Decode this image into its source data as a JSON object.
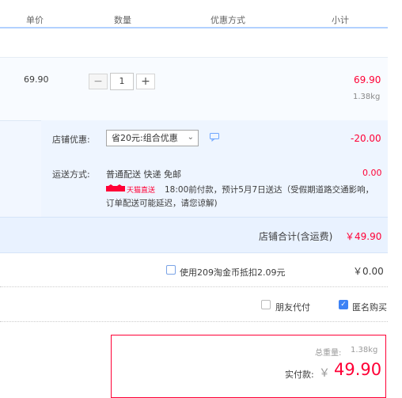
{
  "header": {
    "col_unit_price": "单价",
    "col_quantity": "数量",
    "col_discount": "优惠方式",
    "col_subtotal": "小计"
  },
  "item": {
    "unit_price": "69.90",
    "quantity": "1",
    "minus": "−",
    "plus": "+",
    "subtotal": "69.90",
    "weight": "1.38kg"
  },
  "shop": {
    "discount_label": "店铺优惠:",
    "discount_select": "省20元:组合优惠",
    "discount_amount": "-20.00",
    "shipping_label": "运送方式:",
    "shipping_method": "普通配送 快递 免邮",
    "shipping_fee": "0.00",
    "tmall_badge": "天猫直送",
    "delivery_line1": "18:00前付款，预计5月7日送达（受假期道路交通影响，",
    "delivery_line2": "订单配送可能延迟，请您谅解)",
    "total_label": "店铺合计(含运费)",
    "total_value": "￥49.90"
  },
  "coins": {
    "label": "使用209淘金币抵扣2.09元",
    "value": "￥0.00"
  },
  "options": {
    "friend_pay": "朋友代付",
    "anonymous": "匿名购买"
  },
  "payment": {
    "weight_label": "总重量:",
    "weight_value": "1.38kg",
    "paid_label": "实付款:",
    "currency": "￥",
    "paid_value": "49.90"
  },
  "colors": {
    "accent_red": "#ff0036",
    "accent_blue": "#3d82f5"
  }
}
